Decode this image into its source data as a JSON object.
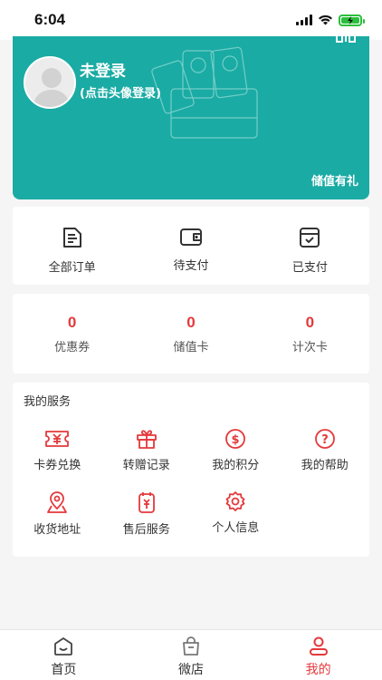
{
  "status_bar": {
    "time": "6:04"
  },
  "profile": {
    "name": "未登录",
    "login_hint": "(点击头像登录)",
    "stored_value_link": "储值有礼"
  },
  "orders": [
    {
      "label": "全部订单",
      "icon": "order-list-icon"
    },
    {
      "label": "待支付",
      "icon": "wallet-icon"
    },
    {
      "label": "已支付",
      "icon": "paid-box-icon"
    }
  ],
  "assets": [
    {
      "value": "0",
      "label": "优惠券"
    },
    {
      "value": "0",
      "label": "储值卡"
    },
    {
      "value": "0",
      "label": "计次卡"
    }
  ],
  "services": {
    "title": "我的服务",
    "items": [
      {
        "label": "卡券兑换",
        "icon": "coupon-exchange-icon"
      },
      {
        "label": "转赠记录",
        "icon": "gift-icon"
      },
      {
        "label": "我的积分",
        "icon": "points-icon"
      },
      {
        "label": "我的帮助",
        "icon": "help-icon"
      },
      {
        "label": "收货地址",
        "icon": "location-icon"
      },
      {
        "label": "售后服务",
        "icon": "after-sales-icon"
      },
      {
        "label": "个人信息",
        "icon": "settings-icon"
      }
    ]
  },
  "tabbar": [
    {
      "label": "首页",
      "icon": "home-icon",
      "active": false
    },
    {
      "label": "微店",
      "icon": "shop-bag-icon",
      "active": false
    },
    {
      "label": "我的",
      "icon": "user-icon",
      "active": true
    }
  ],
  "colors": {
    "accent": "#e4393c",
    "brand_teal": "#1aaba4"
  }
}
